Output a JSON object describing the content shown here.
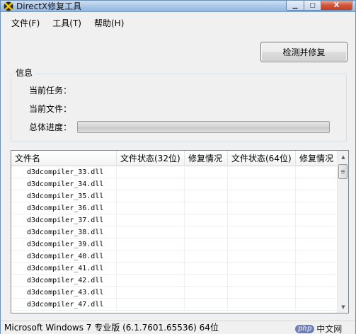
{
  "window": {
    "title": "DirectX修复工具",
    "controls": {
      "minimize": "▁",
      "maximize": "▢",
      "close": "X"
    }
  },
  "menu": [
    "文件(F)",
    "工具(T)",
    "帮助(H)"
  ],
  "check_button": "检测并修复",
  "info_group": {
    "title": "信息",
    "current_task_label": "当前任务：",
    "current_file_label": "当前文件：",
    "overall_progress_label": "总体进度：",
    "overall_progress_value": 0
  },
  "file_list": {
    "columns": [
      "文件名",
      "文件状态(32位)",
      "修复情况",
      "文件状态(64位)",
      "修复情况"
    ],
    "rows": [
      "d3dcompiler_33.dll",
      "d3dcompiler_34.dll",
      "d3dcompiler_35.dll",
      "d3dcompiler_36.dll",
      "d3dcompiler_37.dll",
      "d3dcompiler_38.dll",
      "d3dcompiler_39.dll",
      "d3dcompiler_40.dll",
      "d3dcompiler_41.dll",
      "d3dcompiler_42.dll",
      "d3dcompiler_43.dll",
      "d3dcompiler_47.dll"
    ]
  },
  "status_bar": "Microsoft Windows 7 专业版 (6.1.7601.65536) 64位",
  "watermark": {
    "badge": "php",
    "text": "中文网"
  }
}
